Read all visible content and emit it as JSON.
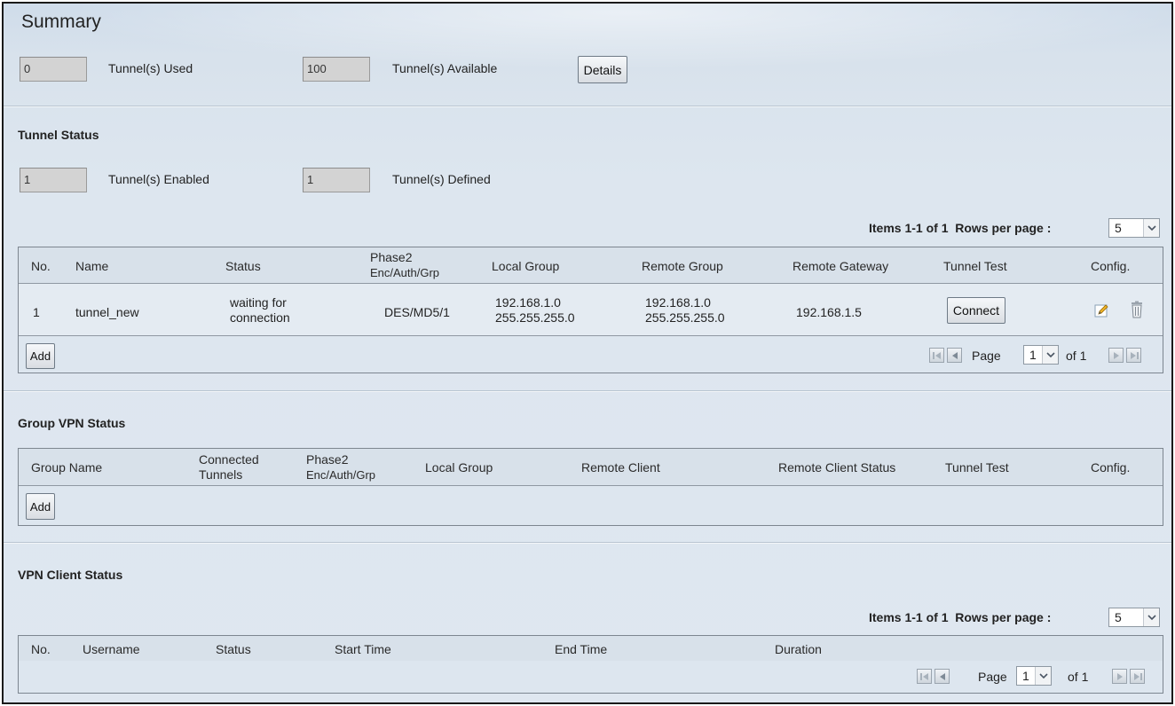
{
  "summary": {
    "title": "Summary",
    "tunnels_used_value": "0",
    "tunnels_used_label": "Tunnel(s) Used",
    "tunnels_available_value": "100",
    "tunnels_available_label": "Tunnel(s) Available",
    "details_button": "Details"
  },
  "tunnel_status": {
    "title": "Tunnel Status",
    "enabled_value": "1",
    "enabled_label": "Tunnel(s) Enabled",
    "defined_value": "1",
    "defined_label": "Tunnel(s) Defined",
    "items_label": "Items 1-1 of 1",
    "rows_per_page_label": "Rows per page :",
    "rows_per_page_value": "5",
    "columns": {
      "no": "No.",
      "name": "Name",
      "status": "Status",
      "phase2_l1": "Phase2",
      "phase2_l2": "Enc/Auth/Grp",
      "local_group": "Local Group",
      "remote_group": "Remote Group",
      "remote_gateway": "Remote Gateway",
      "tunnel_test": "Tunnel Test",
      "config": "Config."
    },
    "row": {
      "no": "1",
      "name": "tunnel_new",
      "status_l1": "waiting for",
      "status_l2": "connection",
      "phase2": "DES/MD5/1",
      "local_ip": "192.168.1.0",
      "local_mask": "255.255.255.0",
      "remote_ip": "192.168.1.0",
      "remote_mask": "255.255.255.0",
      "remote_gateway": "192.168.1.5",
      "connect_button": "Connect"
    },
    "add_button": "Add",
    "pager": {
      "page_label": "Page",
      "page_value": "1",
      "of_label": "of 1"
    }
  },
  "group_vpn": {
    "title": "Group VPN Status",
    "columns": {
      "group_name": "Group Name",
      "connected_l1": "Connected",
      "connected_l2": "Tunnels",
      "phase2_l1": "Phase2",
      "phase2_l2": "Enc/Auth/Grp",
      "local_group": "Local Group",
      "remote_client": "Remote Client",
      "remote_client_status": "Remote Client Status",
      "tunnel_test": "Tunnel Test",
      "config": "Config."
    },
    "add_button": "Add"
  },
  "vpn_client": {
    "title": "VPN Client Status",
    "items_label": "Items 1-1 of 1",
    "rows_per_page_label": "Rows per page :",
    "rows_per_page_value": "5",
    "columns": {
      "no": "No.",
      "username": "Username",
      "status": "Status",
      "start_time": "Start Time",
      "end_time": "End Time",
      "duration": "Duration"
    },
    "pager": {
      "page_label": "Page",
      "page_value": "1",
      "of_label": "of 1"
    }
  },
  "icons": {
    "edit": "pencil-edit-icon",
    "delete": "trash-icon",
    "first": "first-page-icon",
    "prev": "prev-page-icon",
    "next": "next-page-icon",
    "last": "last-page-icon"
  }
}
